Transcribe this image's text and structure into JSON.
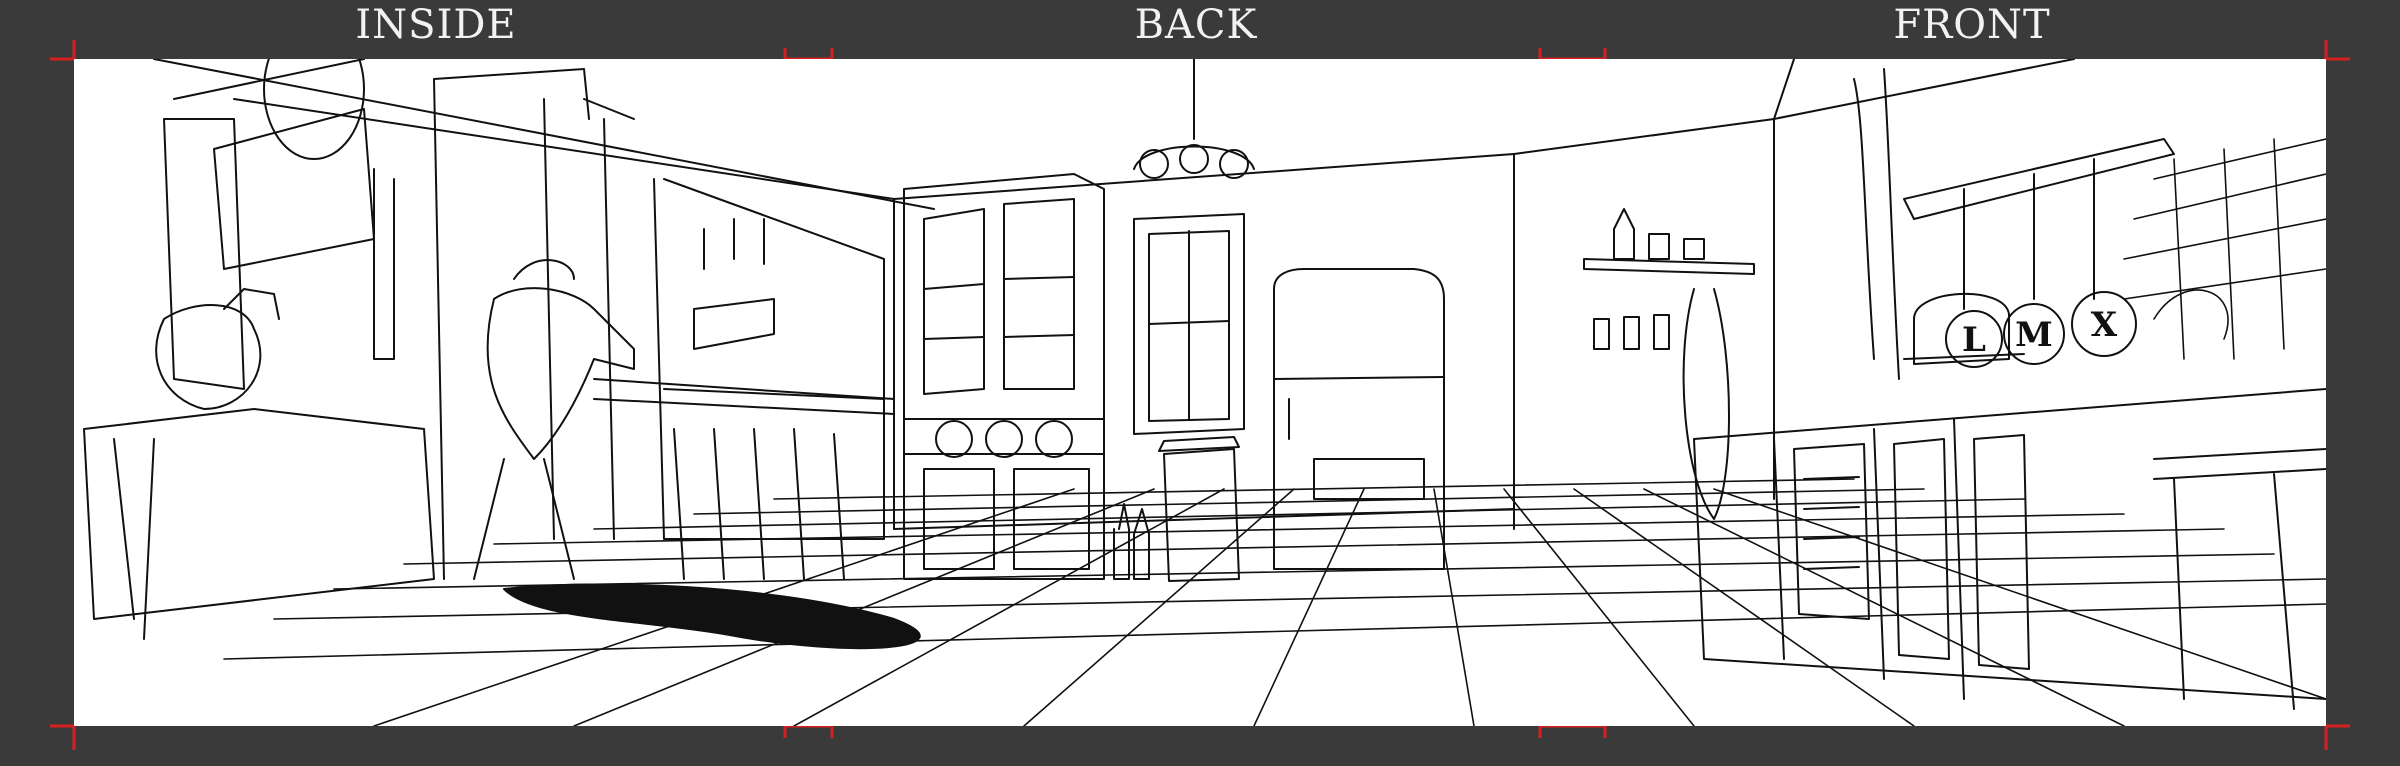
{
  "labels": {
    "left": "INSIDE",
    "center": "BACK",
    "right": "FRONT"
  },
  "pots": [
    "L",
    "M",
    "X"
  ],
  "colors": {
    "background": "#3a3a3a",
    "paper": "#ffffff",
    "line": "#111111",
    "registration": "#d42020",
    "label": "#f2f2f2"
  }
}
